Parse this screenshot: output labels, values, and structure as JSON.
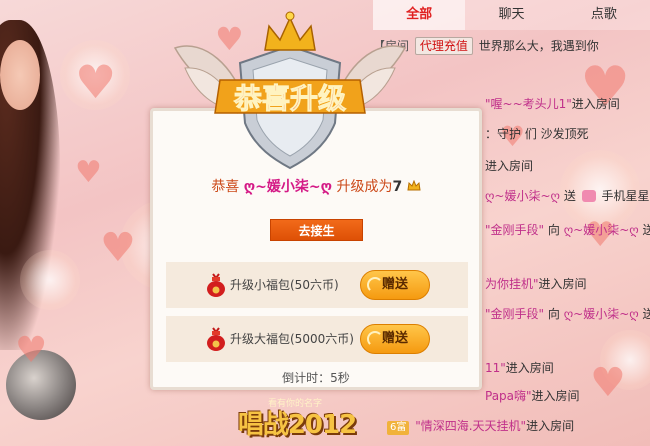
{
  "tabs": [
    {
      "label": "全部",
      "active": true
    },
    {
      "label": "聊天",
      "active": false
    },
    {
      "label": "点歌",
      "active": false
    }
  ],
  "chat": {
    "line1_prefix": "【房间",
    "recharge_label": "代理充值",
    "line1_suffix": "世界那么大，我遇到你",
    "line2_name": "\"喔~~考头儿1\"",
    "line2_text": "进入房间",
    "line3_text": "：守护 们 沙发顶死",
    "line4_text": "进入房间",
    "line5_nick": "ღ~媛小柒~ღ",
    "line5_text": "送",
    "line5_gift": "手机星星，",
    "line6_name": "\"金刚手段\"",
    "line6_mid": "向",
    "line6_nick": "ღ~媛小柒~ღ",
    "line6_text": "送",
    "line7_name": "为你挂机\"",
    "line7_text": "进入房间",
    "line8_name": "\"金刚手段\"",
    "line8_mid": "向",
    "line8_nick": "ღ~媛小柒~ღ",
    "line8_text": "送",
    "line9_name": "11\"",
    "line9_text": "进入房间",
    "line10_name": "Papa嗨\"",
    "line10_text": "进入房间",
    "line11_badge": "6富",
    "line11_name": "\"情深四海.天天挂机\"",
    "line11_text": "进入房间"
  },
  "popup": {
    "emblem_text": "恭喜升级",
    "msg_prefix": "恭喜",
    "msg_nick": "ღ~媛小柒~ღ",
    "msg_middle": "升级成为",
    "msg_level": "7",
    "go_button": "去接生",
    "gifts": [
      {
        "label": "升级小福包(50六币)",
        "button": "赠送"
      },
      {
        "label": "升级大福包(5000六币)",
        "button": "赠送"
      }
    ],
    "countdown": "倒计时：5秒"
  },
  "background": {
    "logo_text": "唱战2012",
    "logo_sub": "看有你的名字"
  },
  "colors": {
    "accent_orange": "#e65a0c",
    "active_tab_red": "#e02020",
    "nick_pink": "#d41a86",
    "gift_button": "#f59a10"
  }
}
